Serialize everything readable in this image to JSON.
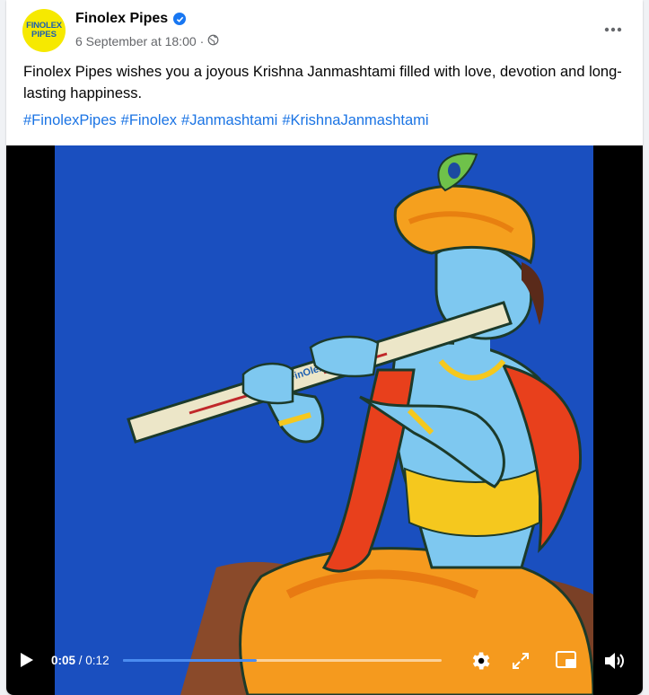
{
  "post": {
    "avatar": {
      "line1": "FINOLEX",
      "line2": "PIPES"
    },
    "page_name": "Finolex Pipes",
    "timestamp": "6 September at 18:00",
    "separator": "·",
    "caption": "Finolex Pipes wishes you a joyous Krishna Janmashtami filled with love, devotion and long-lasting happiness.",
    "hashtags": [
      "#FinolexPipes",
      "#Finolex",
      "#Janmashtami",
      "#KrishnaJanmashtami"
    ]
  },
  "video": {
    "pipe_brand": "FinOlex",
    "current_time": "0:05",
    "total_time": "/ 0:12",
    "progress_fraction": 0.42
  },
  "colors": {
    "brand_blue": "#1b74e4",
    "progress_fill": "#4a8cf0",
    "artwork_bg": "#1a4fbf"
  },
  "icons": {
    "verified": "verified-badge-icon",
    "audience": "globe-icon",
    "more": "more-options-icon",
    "play": "play-icon",
    "settings": "gear-icon",
    "fullscreen": "expand-icon",
    "pip": "picture-in-picture-icon",
    "volume": "volume-icon"
  }
}
